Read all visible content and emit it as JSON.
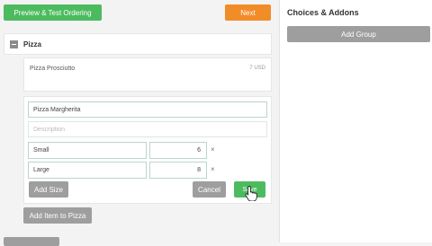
{
  "toolbar": {
    "preview_label": "Preview & Test Ordering",
    "next_label": "Next"
  },
  "group": {
    "title": "Pizza"
  },
  "items": [
    {
      "name": "Pizza Prosciutto",
      "price": "7 USD"
    }
  ],
  "editor": {
    "name_value": "Pizza Margherita",
    "description_placeholder": "Description",
    "sizes": [
      {
        "name": "Small",
        "price": "6"
      },
      {
        "name": "Large",
        "price": "8"
      }
    ],
    "remove_glyph": "×",
    "add_size_label": "Add Size",
    "cancel_label": "Cancel",
    "save_label": "Save"
  },
  "add_item_label": "Add Item to Pizza",
  "right_panel": {
    "title": "Choices & Addons",
    "add_group_label": "Add Group"
  },
  "colors": {
    "green": "#4cbb5f",
    "orange": "#f28c28",
    "gray": "#9e9e9e"
  }
}
